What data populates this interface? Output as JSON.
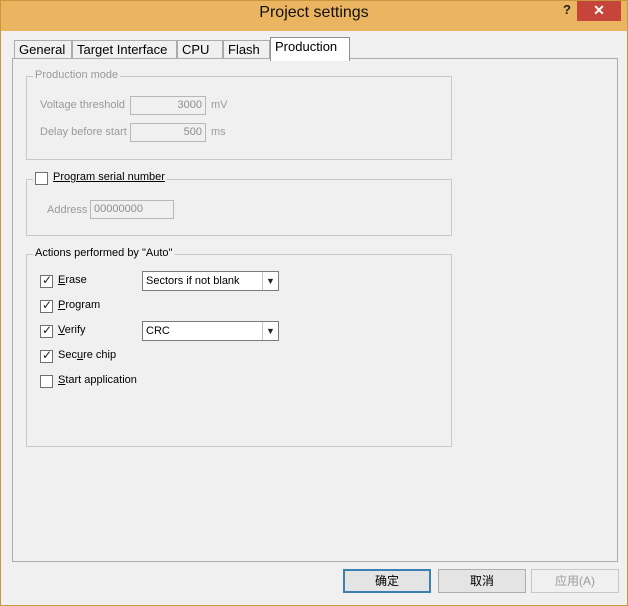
{
  "window": {
    "title": "Project settings",
    "help_label": "?",
    "close_label": "✕"
  },
  "tabs": [
    {
      "label": "General"
    },
    {
      "label": "Target Interface"
    },
    {
      "label": "CPU"
    },
    {
      "label": "Flash"
    },
    {
      "label": "Production"
    }
  ],
  "production_mode": {
    "legend": "Production mode",
    "voltage_label": "Voltage threshold",
    "voltage_value": "3000",
    "voltage_unit": "mV",
    "delay_label": "Delay before start",
    "delay_value": "500",
    "delay_unit": "ms"
  },
  "serial": {
    "checkbox_label": "Program serial number",
    "checked": false,
    "address_label": "Address",
    "address_value": "00000000"
  },
  "actions": {
    "legend": "Actions performed by \"Auto\"",
    "erase": {
      "label": "Erase",
      "checked": true,
      "option": "Sectors if not blank"
    },
    "program": {
      "label": "Program",
      "checked": true
    },
    "verify": {
      "label": "Verify",
      "checked": true,
      "option": "CRC"
    },
    "secure": {
      "label": "Secure chip",
      "checked": true
    },
    "start": {
      "label": "Start application",
      "checked": false
    }
  },
  "buttons": {
    "ok": "确定",
    "cancel": "取消",
    "apply": "应用(A)"
  },
  "icons": {
    "dropdown_arrow": "▼"
  }
}
